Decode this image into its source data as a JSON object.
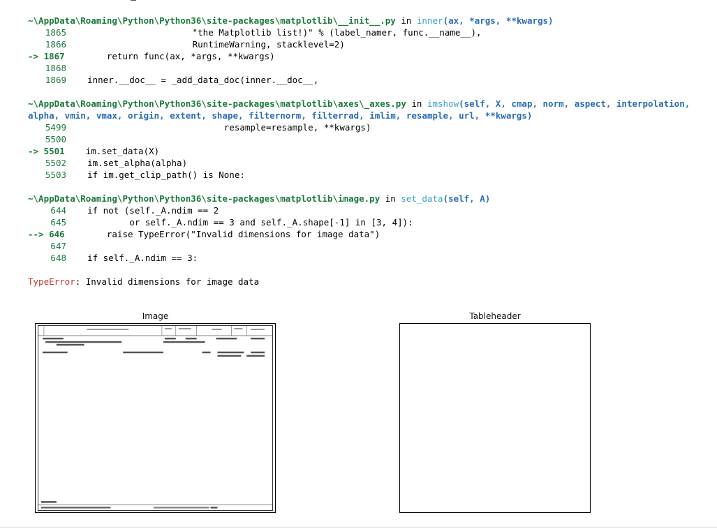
{
  "trace": {
    "frame1": {
      "path": "~\\AppData\\Roaming\\Python\\Python36\\site-packages\\matplotlib\\__init__.py",
      "in_word": " in ",
      "func": "inner",
      "sig": "(ax, *args, **kwargs)",
      "lines": [
        {
          "no": "1865",
          "code": "                        \"the Matplotlib list!)\" % (label_namer, func.__name__),"
        },
        {
          "no": "1866",
          "code": "                        RuntimeWarning, stacklevel=2)"
        },
        {
          "no": "1867",
          "code": "        return func(ax, *args, **kwargs)",
          "current": true,
          "arrow": "-> "
        },
        {
          "no": "1868",
          "code": ""
        },
        {
          "no": "1869",
          "code": "    inner.__doc__ = _add_data_doc(inner.__doc__,"
        }
      ]
    },
    "frame2": {
      "path": "~\\AppData\\Roaming\\Python\\Python36\\site-packages\\matplotlib\\axes\\_axes.py",
      "in_word": " in ",
      "func": "imshow",
      "sig_line1": "(self, X, cmap, norm, aspect, interpolation,",
      "sig_line2": "alpha, vmin, vmax, origin, extent, shape, filternorm, filterrad, imlim, resample, url, **kwargs)",
      "lines": [
        {
          "no": "5499",
          "code": "                              resample=resample, **kwargs)"
        },
        {
          "no": "5500",
          "code": ""
        },
        {
          "no": "5501",
          "code": "    im.set_data(X)",
          "current": true,
          "arrow": "-> "
        },
        {
          "no": "5502",
          "code": "    im.set_alpha(alpha)"
        },
        {
          "no": "5503",
          "code": "    if im.get_clip_path() is None:"
        }
      ]
    },
    "frame3": {
      "path": "~\\AppData\\Roaming\\Python\\Python36\\site-packages\\matplotlib\\image.py",
      "in_word": " in ",
      "func": "set_data",
      "sig": "(self, A)",
      "lines": [
        {
          "no": "644",
          "code": "    if not (self._A.ndim == 2"
        },
        {
          "no": "645",
          "code": "            or self._A.ndim == 3 and self._A.shape[-1] in [3, 4]):"
        },
        {
          "no": "646",
          "code": "        raise TypeError(\"Invalid dimensions for image data\")",
          "current": true,
          "arrow": "--> "
        },
        {
          "no": "647",
          "code": ""
        },
        {
          "no": "648",
          "code": "    if self._A.ndim == 3:"
        }
      ]
    },
    "error_type": "TypeError",
    "error_msg": ": Invalid dimensions for image data"
  },
  "plots": {
    "left_title": "Image",
    "right_title": "Tableheader"
  },
  "doc_image": {
    "footer_left": "Last Page"
  }
}
